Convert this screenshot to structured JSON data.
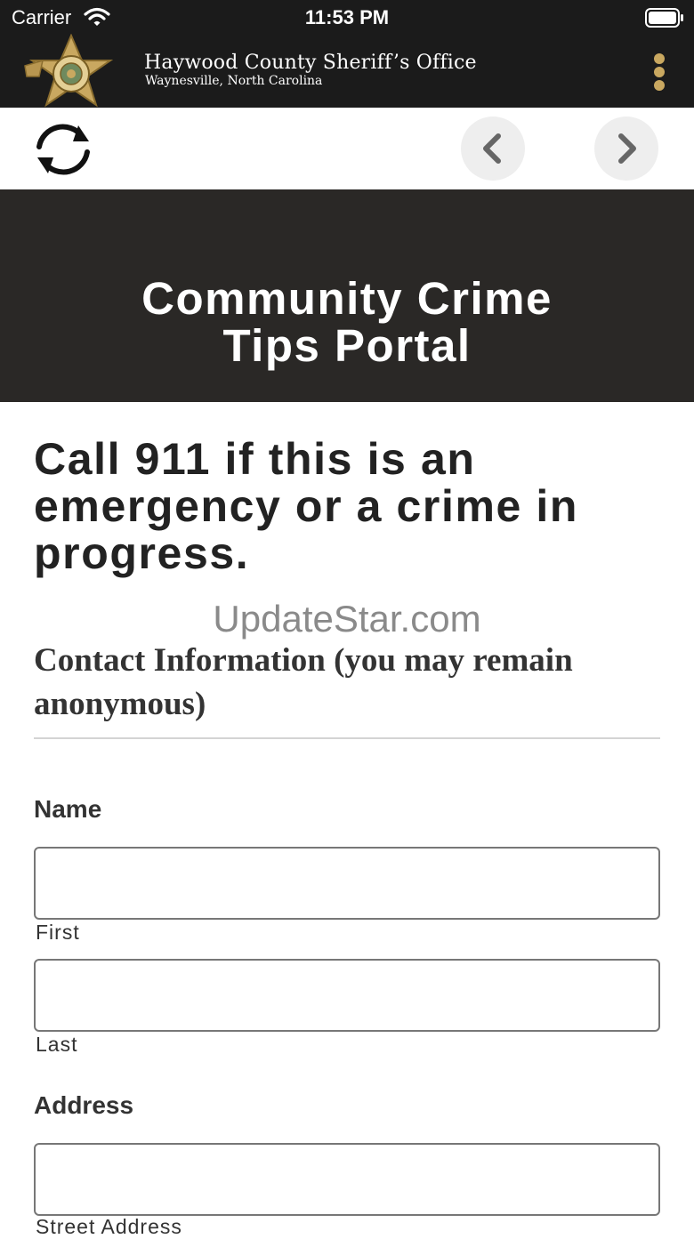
{
  "status_bar": {
    "carrier": "Carrier",
    "time": "11:53 PM"
  },
  "header": {
    "title": "Haywood County Sheriff’s Office",
    "subtitle": "Waynesville, North Carolina",
    "badge_icon": "sheriff-star-badge-icon",
    "menu_icon": "kebab-menu-icon",
    "accent_color": "#c9a860",
    "background_color": "#1b1b1b"
  },
  "toolbar": {
    "refresh_icon": "refresh-icon",
    "back_icon": "chevron-left-icon",
    "forward_icon": "chevron-right-icon"
  },
  "hero": {
    "title_line1": "Community Crime",
    "title_line2": "Tips Portal",
    "background_color": "#2a2826"
  },
  "content": {
    "emergency_notice": "Call 911 if this is an emergency or a crime in progress.",
    "watermark": "UpdateStar.com",
    "section_heading": "Contact Information (you may remain anonymous)"
  },
  "form": {
    "name_label": "Name",
    "first_sublabel": "First",
    "last_sublabel": "Last",
    "first_value": "",
    "last_value": "",
    "address_label": "Address",
    "street_sublabel": "Street Address",
    "street_value": ""
  }
}
